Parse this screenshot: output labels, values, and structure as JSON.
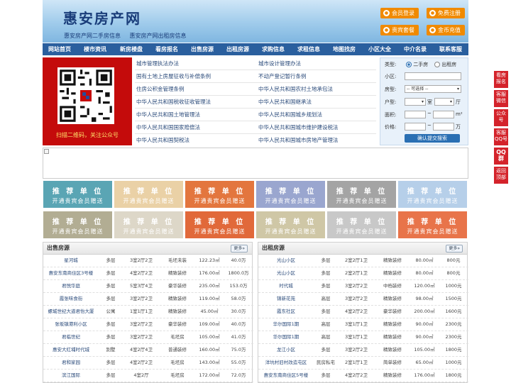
{
  "header": {
    "title": "惠安房产网",
    "sub_links": [
      "惠安房产网二手房信息",
      "惠安房产网出租房信息"
    ],
    "buttons": [
      "会员登录",
      "免费注册",
      "贵宾套餐",
      "金币充值"
    ]
  },
  "nav": [
    "网站首页",
    "楼市资讯",
    "新房楼盘",
    "看房报名",
    "出售房源",
    "出租房源",
    "求购信息",
    "求租信息",
    "地图找房",
    "小区大全",
    "中介名录",
    "联系客服"
  ],
  "qr": {
    "caption": "扫描二维码，关注公众号"
  },
  "links": {
    "left": [
      "城市管理执法办法",
      "国有土地上房屋征收与补偿条例",
      "住房公积金管理条例",
      "中华人民共和国税收征收管理法",
      "中华人民共和国土地管理法",
      "中华人民共和国国家赔偿法",
      "中华人民共和国契税法"
    ],
    "right": [
      "城市设计管理办法",
      "不动产登记暂行条例",
      "中华人民共和国农村土地承包法",
      "中华人民共和国继承法",
      "中华人民共和国城乡规划法",
      "中华人民共和国城市维护建设税法",
      "中华人民共和国城市房地产管理法"
    ]
  },
  "search": {
    "type_label": "类型:",
    "type_options": [
      "二手房",
      "出租房"
    ],
    "community_label": "小区:",
    "house_type_label": "房型:",
    "house_type_value": "-- 可选择 --",
    "layout_label": "户型:",
    "room_unit": "室",
    "hall_unit": "厅",
    "area_label": "面积:",
    "area_unit": "m²",
    "price_label": "价格:",
    "price_unit": "万",
    "range_sep": "~",
    "submit": "确认提交搜索"
  },
  "ads": {
    "title": "推 荐 单 位",
    "subtitle": "开通贵宾会员赠送"
  },
  "side_buttons": [
    "看房报名",
    "客服微信",
    "公众号",
    "客服QQ号",
    "QQ群",
    "返回顶部"
  ],
  "sale": {
    "title": "出售房源",
    "more": "更多»",
    "rows": [
      [
        "星河城",
        "多层",
        "3室2厅2卫",
        "毛坯未装",
        "122.23㎡",
        "40.0万"
      ],
      [
        "惠安东南商住区3号楼",
        "多层",
        "4室2厅2卫",
        "精致装修",
        "176.00㎡",
        "1800.0万"
      ],
      [
        "君悦华庭",
        "多层",
        "5室3厅4卫",
        "豪华装修",
        "235.00㎡",
        "153.0万"
      ],
      [
        "霞张味食街",
        "多层",
        "3室2厅2卫",
        "精致装修",
        "119.00㎡",
        "58.0万"
      ],
      [
        "螺城世纪大道君怡大厦",
        "公寓",
        "1室1厅1卫",
        "精致装修",
        "45.00㎡",
        "30.0万"
      ],
      [
        "张坂镇港利小区",
        "多层",
        "3室2厅2卫",
        "豪华装修",
        "109.00㎡",
        "40.0万"
      ],
      [
        "君临世纪",
        "多层",
        "3室2厅2卫",
        "毛坯房",
        "105.00㎡",
        "41.0万"
      ],
      [
        "惠安大红埔时代城",
        "别墅",
        "4室2厅4卫",
        "普通装修",
        "160.00㎡",
        "75.0万"
      ],
      [
        "君和家园",
        "多层",
        "4室2厅2卫",
        "毛坯房",
        "143.00㎡",
        "55.0万"
      ],
      [
        "滨江国际",
        "多层",
        "4室2厅",
        "毛坯房",
        "172.00㎡",
        "72.0万"
      ]
    ]
  },
  "rent": {
    "title": "出租房源",
    "more": "更多»",
    "rows": [
      [
        "光山小区",
        "多层",
        "2室2厅1卫",
        "精致装修",
        "80.00㎡",
        "800元"
      ],
      [
        "光山小区",
        "多层",
        "2室2厅1卫",
        "精致装修",
        "80.00㎡",
        "800元"
      ],
      [
        "时代城",
        "多层",
        "3室2厅2卫",
        "中档装修",
        "120.00㎡",
        "1000元"
      ],
      [
        "锦新花苑",
        "高层",
        "3室2厅2卫",
        "精致装修",
        "98.00㎡",
        "1500元"
      ],
      [
        "霞东社区",
        "多层",
        "4室2厅2卫",
        "豪华装修",
        "200.00㎡",
        "1600元"
      ],
      [
        "华尔国际1期",
        "高层",
        "3室1厅1卫",
        "精致装修",
        "90.00㎡",
        "2300元"
      ],
      [
        "华尔国际1期",
        "高层",
        "3室1厅1卫",
        "精致装修",
        "90.00㎡",
        "2300元"
      ],
      [
        "龙江小区",
        "多层",
        "3室2厅2卫",
        "精致装修",
        "105.00㎡",
        "1800元"
      ],
      [
        "洋坑村旧村改造屯区",
        "民房私宅",
        "2室1厅1卫",
        "简单装修",
        "65.00㎡",
        "1000元"
      ],
      [
        "惠安东南商住区5号楼",
        "多层",
        "4室2厅2卫",
        "精致装修",
        "176.00㎡",
        "1800元"
      ]
    ]
  }
}
